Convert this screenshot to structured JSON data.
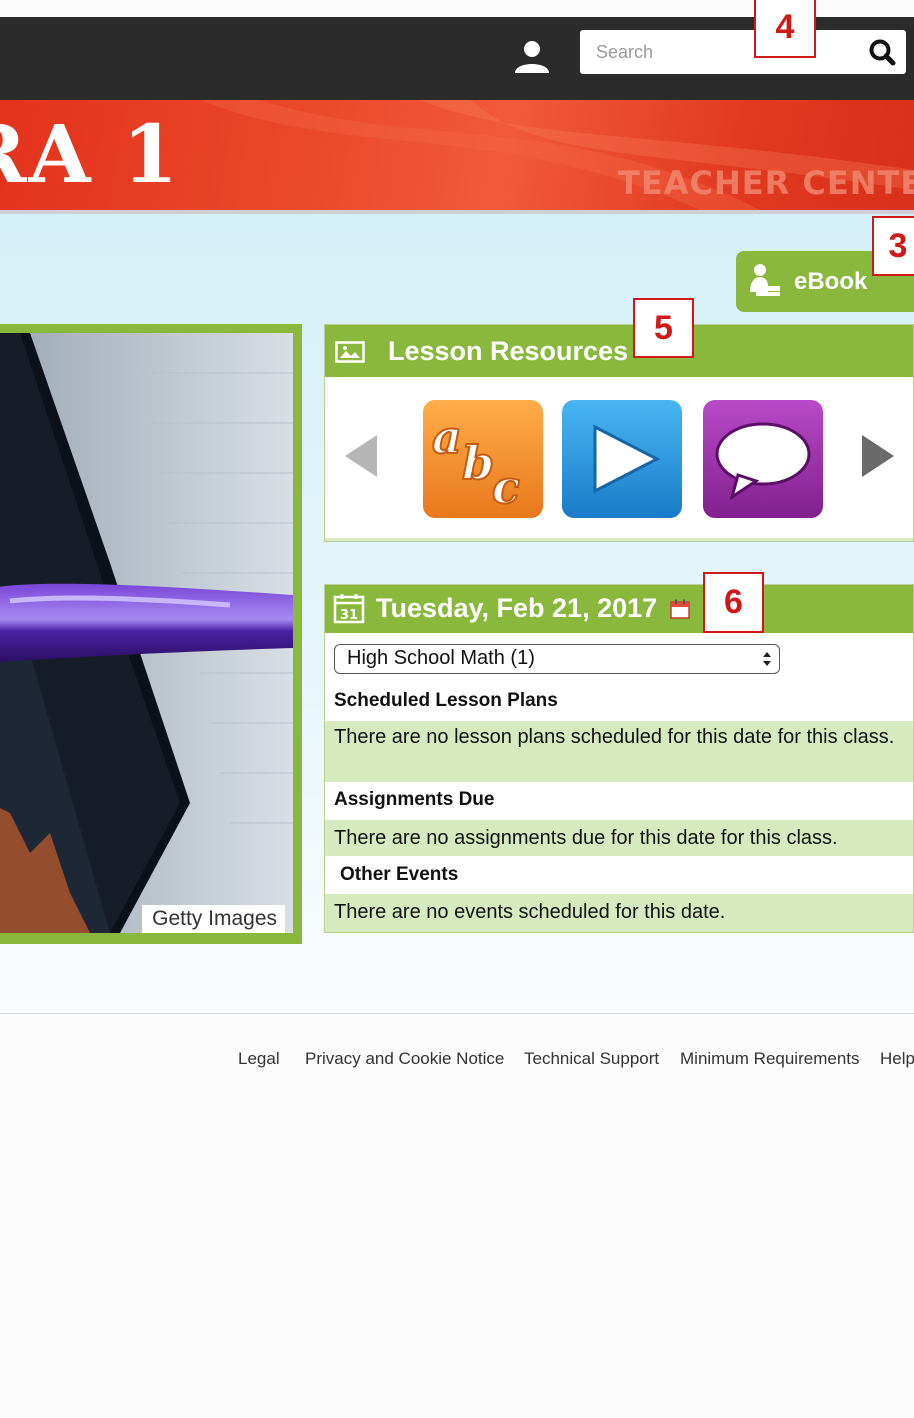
{
  "header": {
    "search_placeholder": "Search"
  },
  "banner": {
    "title": "RA 1",
    "subtitle": "TEACHER CENTER"
  },
  "toolbar": {
    "ebook_label": "eBook"
  },
  "image_panel": {
    "credit": "Getty Images"
  },
  "lesson_resources": {
    "title": "Lesson Resources",
    "tiles": [
      "abc-vocabulary",
      "video-play",
      "discussion-chat"
    ]
  },
  "calendar": {
    "date": "Tuesday, Feb 21, 2017",
    "selected_class": "High School Math (1)",
    "sections": [
      {
        "heading": "Scheduled Lesson Plans",
        "message": "There are no lesson plans scheduled for this date for this class."
      },
      {
        "heading": "Assignments Due",
        "message": "There are no assignments due for this date for this class."
      },
      {
        "heading": "Other Events",
        "message": "There are no events scheduled for this date."
      }
    ]
  },
  "footer": {
    "links": [
      "Legal",
      "Privacy and Cookie Notice",
      "Technical Support",
      "Minimum Requirements",
      "Help"
    ]
  },
  "callouts": [
    "4",
    "3",
    "5",
    "6"
  ],
  "colors": {
    "topbar": "#2b2b2b",
    "banner_red": "#e4321c",
    "accent_green": "#8ab83c",
    "row_green": "#d6e9bf",
    "callout_red": "#d01818"
  }
}
